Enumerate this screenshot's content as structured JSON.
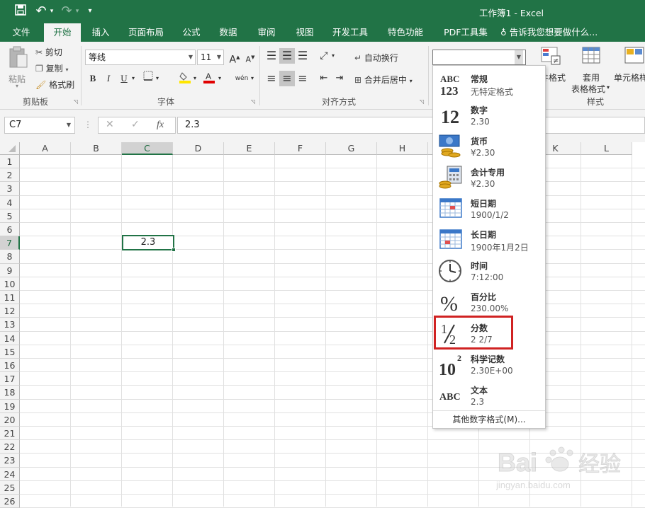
{
  "window": {
    "title": "工作簿1 - Excel"
  },
  "quick_access": {
    "undo": "↶",
    "redo": "↷",
    "more": "▾"
  },
  "menu": {
    "tabs": [
      "文件",
      "开始",
      "插入",
      "页面布局",
      "公式",
      "数据",
      "审阅",
      "视图",
      "开发工具",
      "特色功能",
      "PDF工具集"
    ],
    "tell_me": "告诉我您想要做什么..."
  },
  "ribbon": {
    "clipboard": {
      "paste": "粘贴",
      "cut": "剪切",
      "copy": "复制",
      "format_painter": "格式刷",
      "group": "剪贴板"
    },
    "font": {
      "name": "等线",
      "size": "11",
      "grow": "A",
      "shrink": "A",
      "bold": "B",
      "italic": "I",
      "underline": "U",
      "phonetic": "wén",
      "group": "字体"
    },
    "alignment": {
      "wrap": "自动换行",
      "merge": "合并后居中",
      "group": "对齐方式"
    },
    "number": {
      "format_value": ""
    },
    "styles": {
      "conditional": "件格式",
      "table_format_l1": "套用",
      "table_format_l2": "表格格式",
      "cell_styles": "单元格样",
      "group": "样式"
    }
  },
  "formula_bar": {
    "name_box": "C7",
    "fx": "fx",
    "value": "2.3"
  },
  "grid": {
    "columns": [
      "A",
      "B",
      "C",
      "D",
      "E",
      "F",
      "G",
      "H",
      "I",
      "J",
      "K",
      "L"
    ],
    "rows": [
      "1",
      "2",
      "3",
      "4",
      "5",
      "6",
      "7",
      "8",
      "9",
      "10",
      "11",
      "12",
      "13",
      "14",
      "15",
      "16",
      "17",
      "18",
      "19",
      "20",
      "21",
      "22",
      "23",
      "24",
      "25",
      "26"
    ],
    "selected_cell": {
      "ref": "C7",
      "value": "2.3"
    }
  },
  "number_format_menu": {
    "items": [
      {
        "name": "常规",
        "example": "无特定格式",
        "icon": "general-abc123-icon"
      },
      {
        "name": "数字",
        "example": "2.30",
        "icon": "number-12-icon"
      },
      {
        "name": "货币",
        "example": "¥2.30",
        "icon": "currency-icon"
      },
      {
        "name": "会计专用",
        "example": " ¥2.30",
        "icon": "accounting-icon"
      },
      {
        "name": "短日期",
        "example": "1900/1/2",
        "icon": "short-date-icon"
      },
      {
        "name": "长日期",
        "example": "1900年1月2日",
        "icon": "long-date-icon"
      },
      {
        "name": "时间",
        "example": "7:12:00",
        "icon": "clock-icon"
      },
      {
        "name": "百分比",
        "example": "230.00%",
        "icon": "percent-icon"
      },
      {
        "name": "分数",
        "example": "2 2/7",
        "icon": "fraction-icon"
      },
      {
        "name": "科学记数",
        "example": "2.30E+00",
        "icon": "scientific-icon"
      },
      {
        "name": "文本",
        "example": "2.3",
        "icon": "text-abc-icon"
      }
    ],
    "more": "其他数字格式(M)...",
    "highlighted": "分数"
  },
  "watermark": {
    "brand": "Bai",
    "brand2": "经验",
    "url": "jingyan.baidu.com"
  },
  "colors": {
    "excel_green": "#217346",
    "highlight_red": "#d02222"
  }
}
